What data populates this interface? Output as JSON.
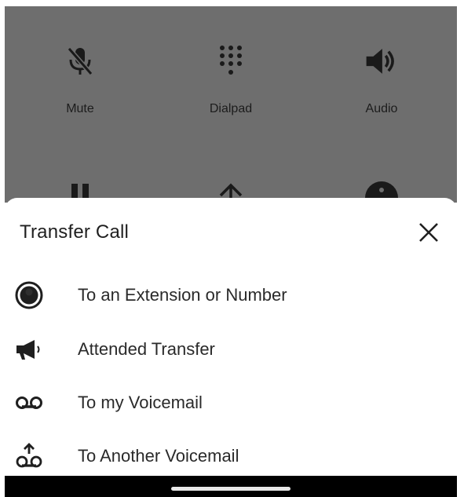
{
  "call_controls": {
    "row1": [
      {
        "label": "Mute",
        "icon": "mic-off-icon"
      },
      {
        "label": "Dialpad",
        "icon": "dialpad-icon"
      },
      {
        "label": "Audio",
        "icon": "speaker-icon"
      }
    ],
    "row2_icons": [
      "pause-icon",
      "arrow-up-icon",
      "info-icon"
    ]
  },
  "transfer_sheet": {
    "title": "Transfer Call",
    "close_icon": "close-icon",
    "options": [
      {
        "label": "To an Extension or Number",
        "icon": "contact-icon"
      },
      {
        "label": "Attended Transfer",
        "icon": "megaphone-icon"
      },
      {
        "label": "To my Voicemail",
        "icon": "voicemail-icon"
      },
      {
        "label": "To Another Voicemail",
        "icon": "voicemail-upload-icon"
      }
    ]
  },
  "colors": {
    "overlay_gray": "#6e6e6e",
    "sheet_bg": "#ffffff",
    "text_primary": "#1f1f1f",
    "navbar_bg": "#000000"
  }
}
